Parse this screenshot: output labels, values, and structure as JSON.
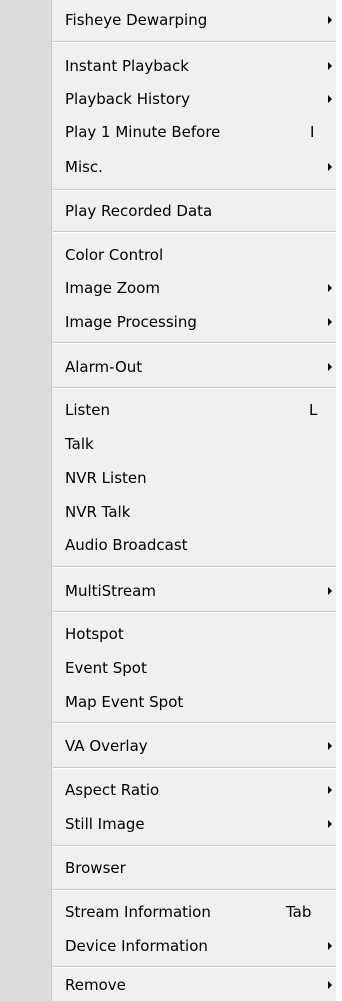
{
  "menu": {
    "items": [
      {
        "label": "Fisheye Dewarping",
        "submenu": true
      },
      {
        "label": "Instant Playback",
        "submenu": true
      },
      {
        "label": "Playback History",
        "submenu": true
      },
      {
        "label": "Play 1 Minute Before",
        "shortcut": "I"
      },
      {
        "label": "Misc.",
        "submenu": true
      },
      {
        "label": "Play Recorded Data"
      },
      {
        "label": "Color Control"
      },
      {
        "label": "Image Zoom",
        "submenu": true
      },
      {
        "label": "Image Processing",
        "submenu": true
      },
      {
        "label": "Alarm-Out",
        "submenu": true
      },
      {
        "label": "Listen",
        "shortcut": "L"
      },
      {
        "label": "Talk"
      },
      {
        "label": "NVR Listen"
      },
      {
        "label": "NVR Talk"
      },
      {
        "label": "Audio Broadcast"
      },
      {
        "label": "MultiStream",
        "submenu": true
      },
      {
        "label": "Hotspot"
      },
      {
        "label": "Event Spot"
      },
      {
        "label": "Map Event Spot"
      },
      {
        "label": "VA Overlay",
        "submenu": true
      },
      {
        "label": "Aspect Ratio",
        "submenu": true
      },
      {
        "label": "Still Image",
        "submenu": true
      },
      {
        "label": "Browser"
      },
      {
        "label": "Stream Information",
        "shortcut": "Tab"
      },
      {
        "label": "Device Information",
        "submenu": true
      },
      {
        "label": "Remove",
        "submenu": true
      }
    ]
  },
  "colors": {
    "menu_background": "#f0f0f0",
    "gutter": "#dcdcdc",
    "separator": "#c8c8c8",
    "text": "#000000"
  }
}
